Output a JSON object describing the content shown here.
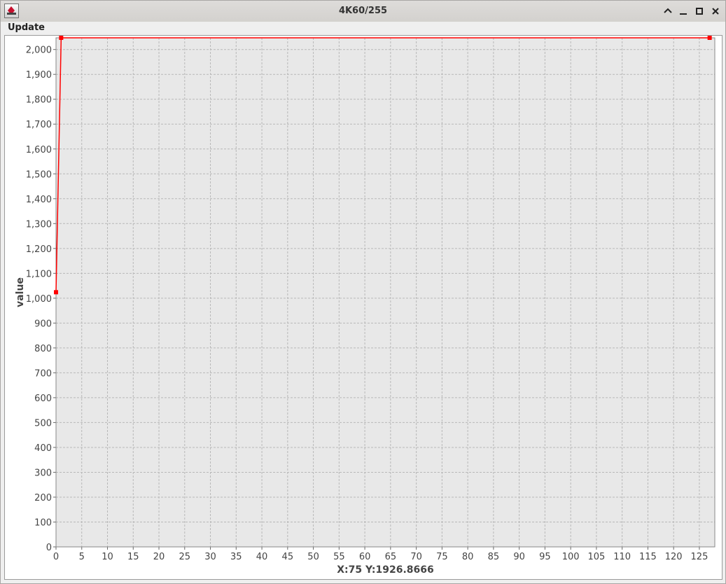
{
  "window": {
    "title": "4K60/255",
    "app_icon": "java-app-icon",
    "controls": [
      "collapse-icon",
      "minimize-icon",
      "maximize-icon",
      "close-icon"
    ]
  },
  "menu": {
    "items": [
      {
        "label": "Update"
      }
    ]
  },
  "chart_data": {
    "type": "line",
    "title": "",
    "xlabel": "X:75 Y:1926.8666",
    "ylabel": "value",
    "xlim": [
      0,
      128
    ],
    "ylim": [
      0,
      2047
    ],
    "grid": true,
    "x_ticks": [
      0,
      5,
      10,
      15,
      20,
      25,
      30,
      35,
      40,
      45,
      50,
      55,
      60,
      65,
      70,
      75,
      80,
      85,
      90,
      95,
      100,
      105,
      110,
      115,
      120,
      125
    ],
    "y_ticks": [
      0,
      100,
      200,
      300,
      400,
      500,
      600,
      700,
      800,
      900,
      1000,
      1100,
      1200,
      1300,
      1400,
      1500,
      1600,
      1700,
      1800,
      1900,
      2000
    ],
    "series": [
      {
        "color": "#ff0000",
        "x": [
          0,
          1,
          2,
          3,
          4,
          5,
          6,
          7,
          8,
          9,
          10,
          11,
          12,
          13,
          14,
          15,
          16,
          17,
          18,
          19,
          20,
          21,
          22,
          23,
          24,
          25,
          26,
          27,
          28,
          29,
          30,
          31,
          32,
          33,
          34,
          35,
          36,
          37,
          38,
          39,
          40,
          41,
          42,
          43,
          44,
          45,
          46,
          47,
          48,
          49,
          50,
          51,
          52,
          53,
          54,
          55,
          56,
          57,
          58,
          59,
          60,
          61,
          62,
          63,
          64,
          65,
          66,
          67,
          68,
          69,
          70,
          71,
          72,
          73,
          74,
          75,
          76,
          77,
          78,
          79,
          80,
          81,
          82,
          83,
          84,
          85,
          86,
          87,
          88,
          89,
          90,
          91,
          92,
          93,
          94,
          95,
          96,
          97,
          98,
          99,
          100,
          101,
          102,
          103,
          104,
          105,
          106,
          107,
          108,
          109,
          110,
          111,
          112,
          113,
          114,
          115,
          116,
          117,
          118,
          119,
          120,
          121,
          122,
          123,
          124,
          125,
          126,
          127
        ],
        "y": [
          1024,
          2047,
          2047,
          2047,
          2047,
          2047,
          2047,
          2047,
          2047,
          2047,
          2047,
          2047,
          2047,
          2047,
          2047,
          2047,
          2047,
          2047,
          2047,
          2047,
          2047,
          2047,
          2047,
          2047,
          2047,
          2047,
          2047,
          2047,
          2047,
          2047,
          2047,
          2047,
          2047,
          2047,
          2047,
          2047,
          2047,
          2047,
          2047,
          2047,
          2047,
          2047,
          2047,
          2047,
          2047,
          2047,
          2047,
          2047,
          2047,
          2047,
          2047,
          2047,
          2047,
          2047,
          2047,
          2047,
          2047,
          2047,
          2047,
          2047,
          2047,
          2047,
          2047,
          2047,
          2047,
          2047,
          2047,
          2047,
          2047,
          2047,
          2047,
          2047,
          2047,
          2047,
          2047,
          2047,
          2047,
          2047,
          2047,
          2047,
          2047,
          2047,
          2047,
          2047,
          2047,
          2047,
          2047,
          2047,
          2047,
          2047,
          2047,
          2047,
          2047,
          2047,
          2047,
          2047,
          2047,
          2047,
          2047,
          2047,
          2047,
          2047,
          2047,
          2047,
          2047,
          2047,
          2047,
          2047,
          2047,
          2047,
          2047,
          2047,
          2047,
          2047,
          2047,
          2047,
          2047,
          2047,
          2047,
          2047,
          2047,
          2047,
          2047,
          2047,
          2047,
          2047,
          2047,
          2047
        ],
        "markers": [
          0,
          1,
          127
        ]
      }
    ]
  },
  "colors": {
    "plot_background": "#e8e8e8",
    "grid": "#b8b8b8",
    "series": "#ff0000"
  }
}
